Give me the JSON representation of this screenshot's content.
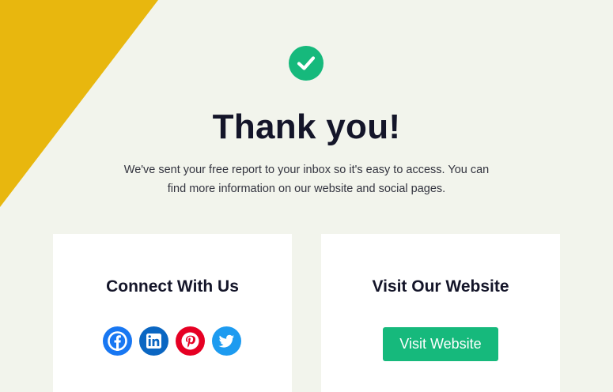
{
  "page": {
    "title": "Thank you!",
    "message": "We've sent your free report to your inbox so it's easy to access. You can find more information on our website and social pages.",
    "success_icon": "check-circle-icon"
  },
  "connect_card": {
    "title": "Connect With Us",
    "social_links": [
      {
        "network": "Facebook",
        "icon": "facebook-icon",
        "color": "#1877f2"
      },
      {
        "network": "LinkedIn",
        "icon": "linkedin-icon",
        "color": "#0a66c2"
      },
      {
        "network": "Pinterest",
        "icon": "pinterest-icon",
        "color": "#e60023"
      },
      {
        "network": "Twitter",
        "icon": "twitter-icon",
        "color": "#1d9bf0"
      }
    ]
  },
  "website_card": {
    "title": "Visit Our Website",
    "button_label": "Visit Website"
  },
  "colors": {
    "background": "#f2f4ec",
    "accent_yellow": "#e8b70e",
    "brand_green": "#16b97c",
    "heading": "#141529",
    "card": "#ffffff"
  }
}
